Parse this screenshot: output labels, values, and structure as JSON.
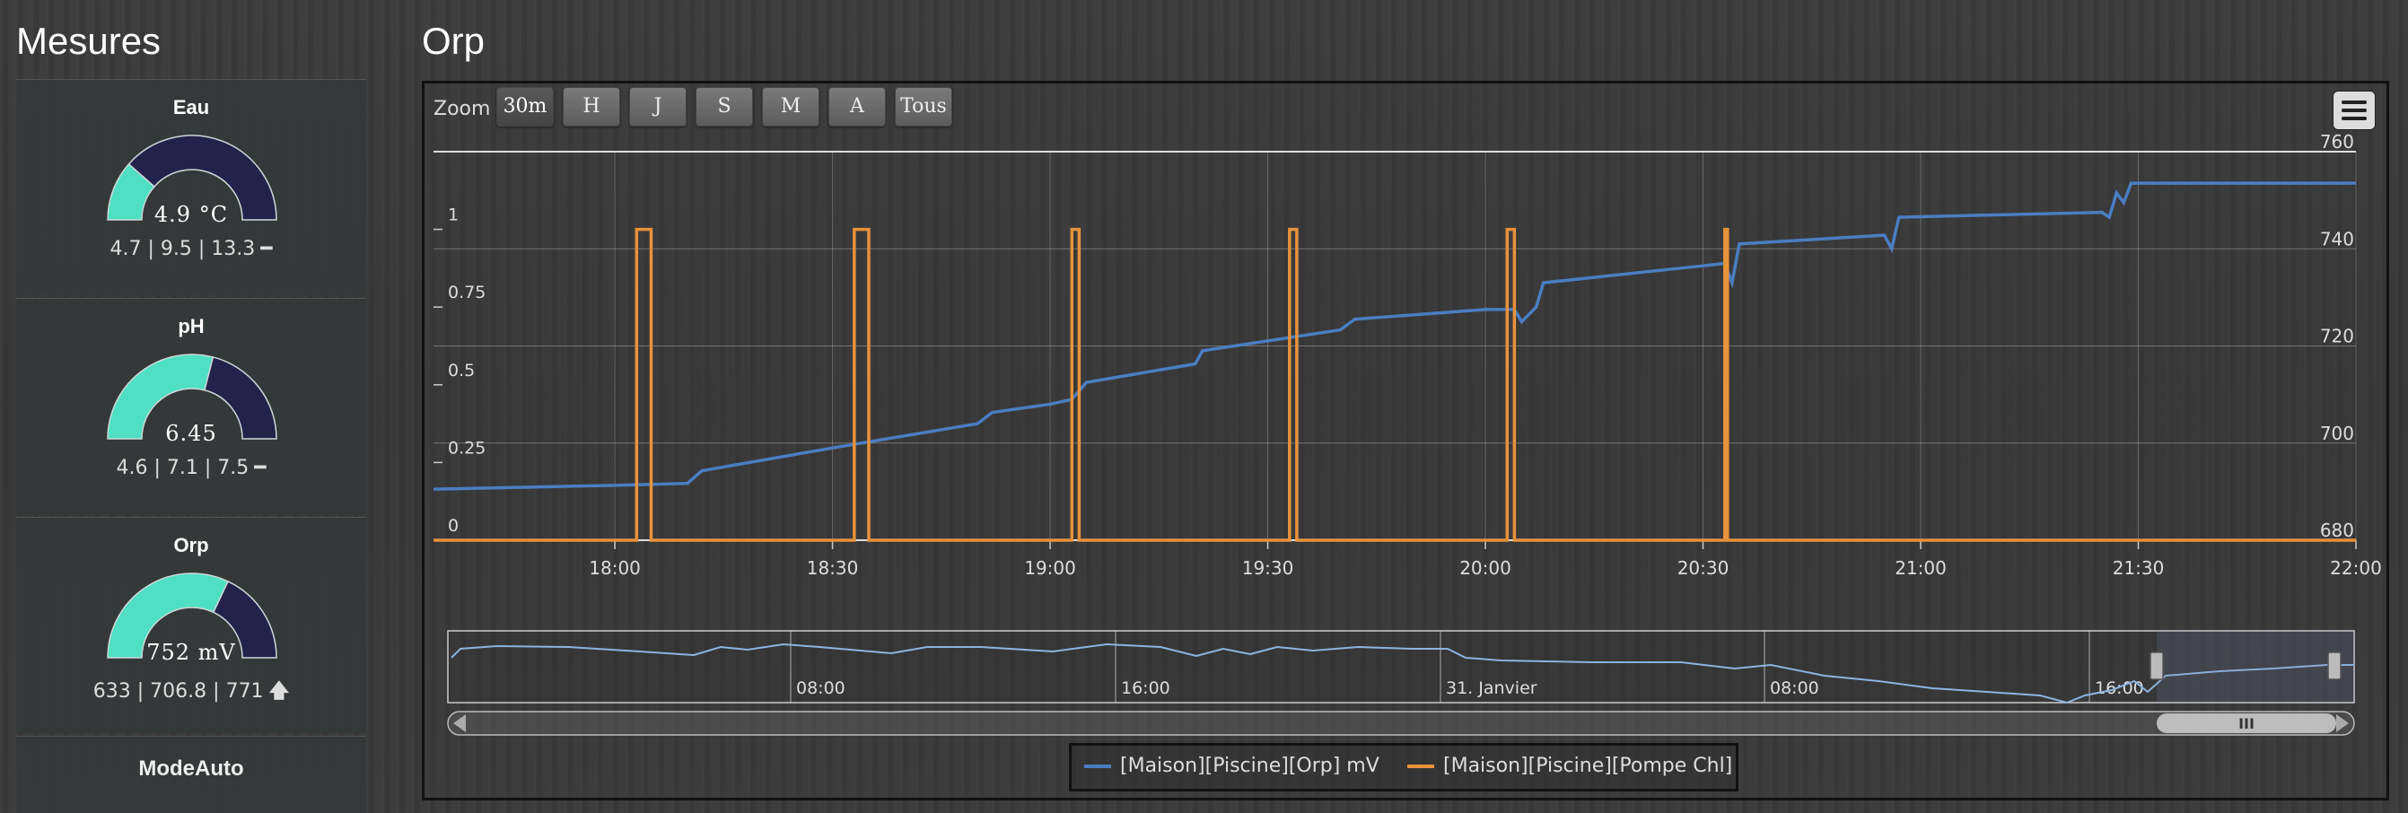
{
  "sidebar": {
    "title": "Mesures",
    "widgets": [
      {
        "title": "Eau",
        "value": "4.9 °C",
        "fraction": 0.23,
        "stats": "4.7 | 9.5 | 13.3",
        "trend": "━",
        "trend_icon": "dash-icon"
      },
      {
        "title": "pH",
        "value": "6.45",
        "fraction": 0.58,
        "stats": "4.6 | 7.1 | 7.5",
        "trend": "━",
        "trend_icon": "dash-icon"
      },
      {
        "title": "Orp",
        "value": "752 mV",
        "fraction": 0.64,
        "stats": "633 | 706.8 | 771",
        "trend": "🡅",
        "trend_icon": "arrow-up-icon"
      }
    ],
    "mode_label": "ModeAuto"
  },
  "colors": {
    "gauge_fill": "#4fdfc2",
    "gauge_track": "#24224a",
    "orp_line": "#4a7ec2",
    "pump_line": "#e8923a"
  },
  "chart": {
    "title": "Orp",
    "zoom_label": "Zoom",
    "zoom_buttons": [
      "30m",
      "H",
      "J",
      "S",
      "M",
      "A",
      "Tous"
    ],
    "active_zoom": "30m",
    "legend": [
      "[Maison][Piscine][Orp] mV",
      "[Maison][Piscine][Pompe Chl]"
    ],
    "navigator_labels": [
      "08:00",
      "16:00",
      "31. Janvier",
      "08:00",
      "16:00"
    ],
    "scrollbar_grip": "III"
  },
  "chart_data": {
    "type": "line",
    "x_ticks": [
      "18:00",
      "18:30",
      "19:00",
      "19:30",
      "20:00",
      "20:30",
      "21:00",
      "21:30",
      "22:00"
    ],
    "xlim": [
      "17:35",
      "22:00"
    ],
    "left_axis": {
      "ticks": [
        "0",
        "0.25",
        "0.5",
        "0.75",
        "1"
      ],
      "range": [
        0,
        1.25
      ]
    },
    "right_axis": {
      "ticks": [
        "680",
        "700",
        "720",
        "740",
        "760"
      ],
      "range": [
        680,
        760
      ]
    },
    "series": [
      {
        "name": "[Maison][Piscine][Orp] mV",
        "axis": "right",
        "points": [
          [
            "17:35",
            690.5
          ],
          [
            "18:00",
            691.3
          ],
          [
            "18:10",
            691.7
          ],
          [
            "18:12",
            694.3
          ],
          [
            "18:30",
            699.0
          ],
          [
            "18:50",
            704.0
          ],
          [
            "18:52",
            706.3
          ],
          [
            "19:00",
            708.0
          ],
          [
            "19:03",
            709.0
          ],
          [
            "19:05",
            712.5
          ],
          [
            "19:20",
            716.3
          ],
          [
            "19:21",
            719.0
          ],
          [
            "19:40",
            723.3
          ],
          [
            "19:42",
            725.5
          ],
          [
            "20:00",
            727.5
          ],
          [
            "20:04",
            727.5
          ],
          [
            "20:05",
            725.0
          ],
          [
            "20:07",
            728.0
          ],
          [
            "20:08",
            733.0
          ],
          [
            "20:30",
            736.5
          ],
          [
            "20:33",
            737.0
          ],
          [
            "20:34",
            733.0
          ],
          [
            "20:35",
            741.0
          ],
          [
            "20:55",
            742.8
          ],
          [
            "20:56",
            740.0
          ],
          [
            "20:57",
            746.5
          ],
          [
            "21:25",
            747.5
          ],
          [
            "21:26",
            746.5
          ],
          [
            "21:27",
            751.5
          ],
          [
            "21:28",
            749.5
          ],
          [
            "21:29",
            753.5
          ],
          [
            "22:00",
            753.5
          ]
        ]
      },
      {
        "name": "[Maison][Piscine][Pompe Chl]",
        "axis": "left",
        "pulses": [
          [
            "18:03",
            "18:05"
          ],
          [
            "18:33",
            "18:35"
          ],
          [
            "19:03",
            "19:04"
          ],
          [
            "19:33",
            "19:34"
          ],
          [
            "20:03",
            "20:04"
          ],
          [
            "20:33",
            "20:33"
          ]
        ],
        "high": 1,
        "low": 0
      }
    ]
  }
}
